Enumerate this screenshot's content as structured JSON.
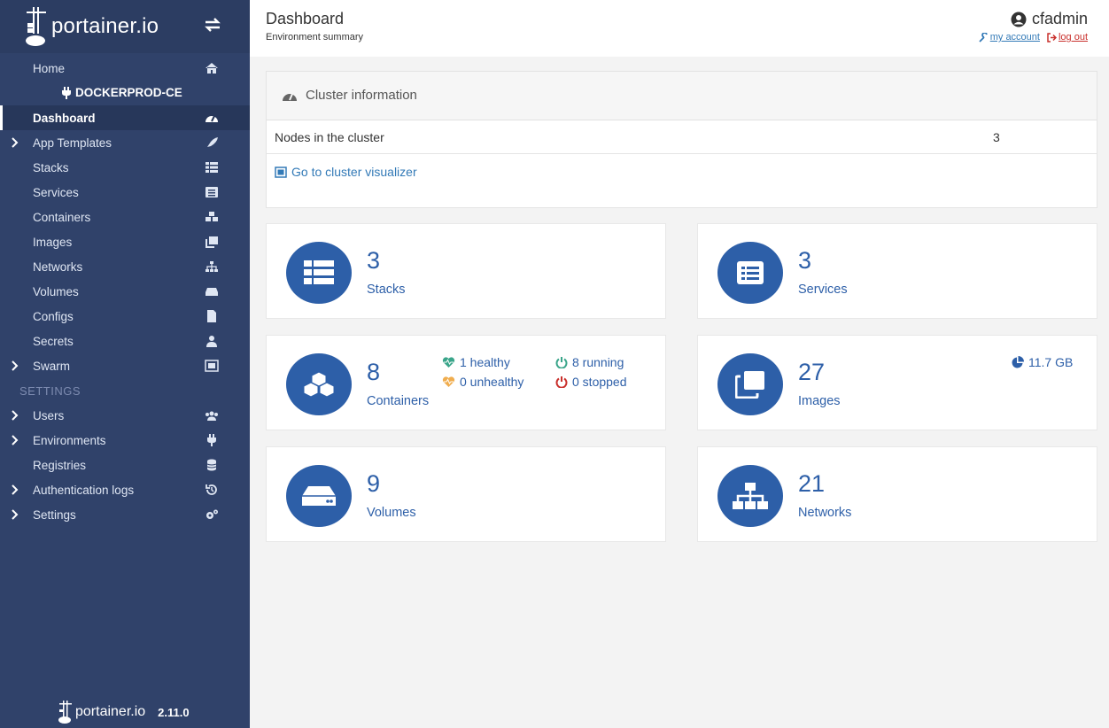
{
  "sidebar": {
    "brand": "portainer.io",
    "home": "Home",
    "environment": "DOCKERPROD-CE",
    "items": [
      {
        "label": "Dashboard"
      },
      {
        "label": "App Templates"
      },
      {
        "label": "Stacks"
      },
      {
        "label": "Services"
      },
      {
        "label": "Containers"
      },
      {
        "label": "Images"
      },
      {
        "label": "Networks"
      },
      {
        "label": "Volumes"
      },
      {
        "label": "Configs"
      },
      {
        "label": "Secrets"
      },
      {
        "label": "Swarm"
      }
    ],
    "settings_header": "SETTINGS",
    "settings_items": [
      {
        "label": "Users"
      },
      {
        "label": "Environments"
      },
      {
        "label": "Registries"
      },
      {
        "label": "Authentication logs"
      },
      {
        "label": "Settings"
      }
    ],
    "footer_brand": "portainer.io",
    "version": "2.11.0"
  },
  "header": {
    "title": "Dashboard",
    "subtitle": "Environment summary",
    "username": "cfadmin",
    "my_account": "my account",
    "log_out": "log out"
  },
  "cluster": {
    "title": "Cluster information",
    "nodes_label": "Nodes in the cluster",
    "nodes_value": "3",
    "visualizer_link": "Go to cluster visualizer"
  },
  "widgets": {
    "stacks": {
      "count": "3",
      "label": "Stacks"
    },
    "services": {
      "count": "3",
      "label": "Services"
    },
    "containers": {
      "count": "8",
      "label": "Containers",
      "healthy": "1 healthy",
      "unhealthy": "0 unhealthy",
      "running": "8 running",
      "stopped": "0 stopped"
    },
    "images": {
      "count": "27",
      "label": "Images",
      "size": "11.7 GB"
    },
    "volumes": {
      "count": "9",
      "label": "Volumes"
    },
    "networks": {
      "count": "21",
      "label": "Networks"
    }
  },
  "colors": {
    "sidebar": "#30426a",
    "accent": "#2d5fa8",
    "healthy": "#3aa58a",
    "unhealthy": "#f0ad4e",
    "running": "#3aa58a",
    "stopped": "#c9302c"
  }
}
